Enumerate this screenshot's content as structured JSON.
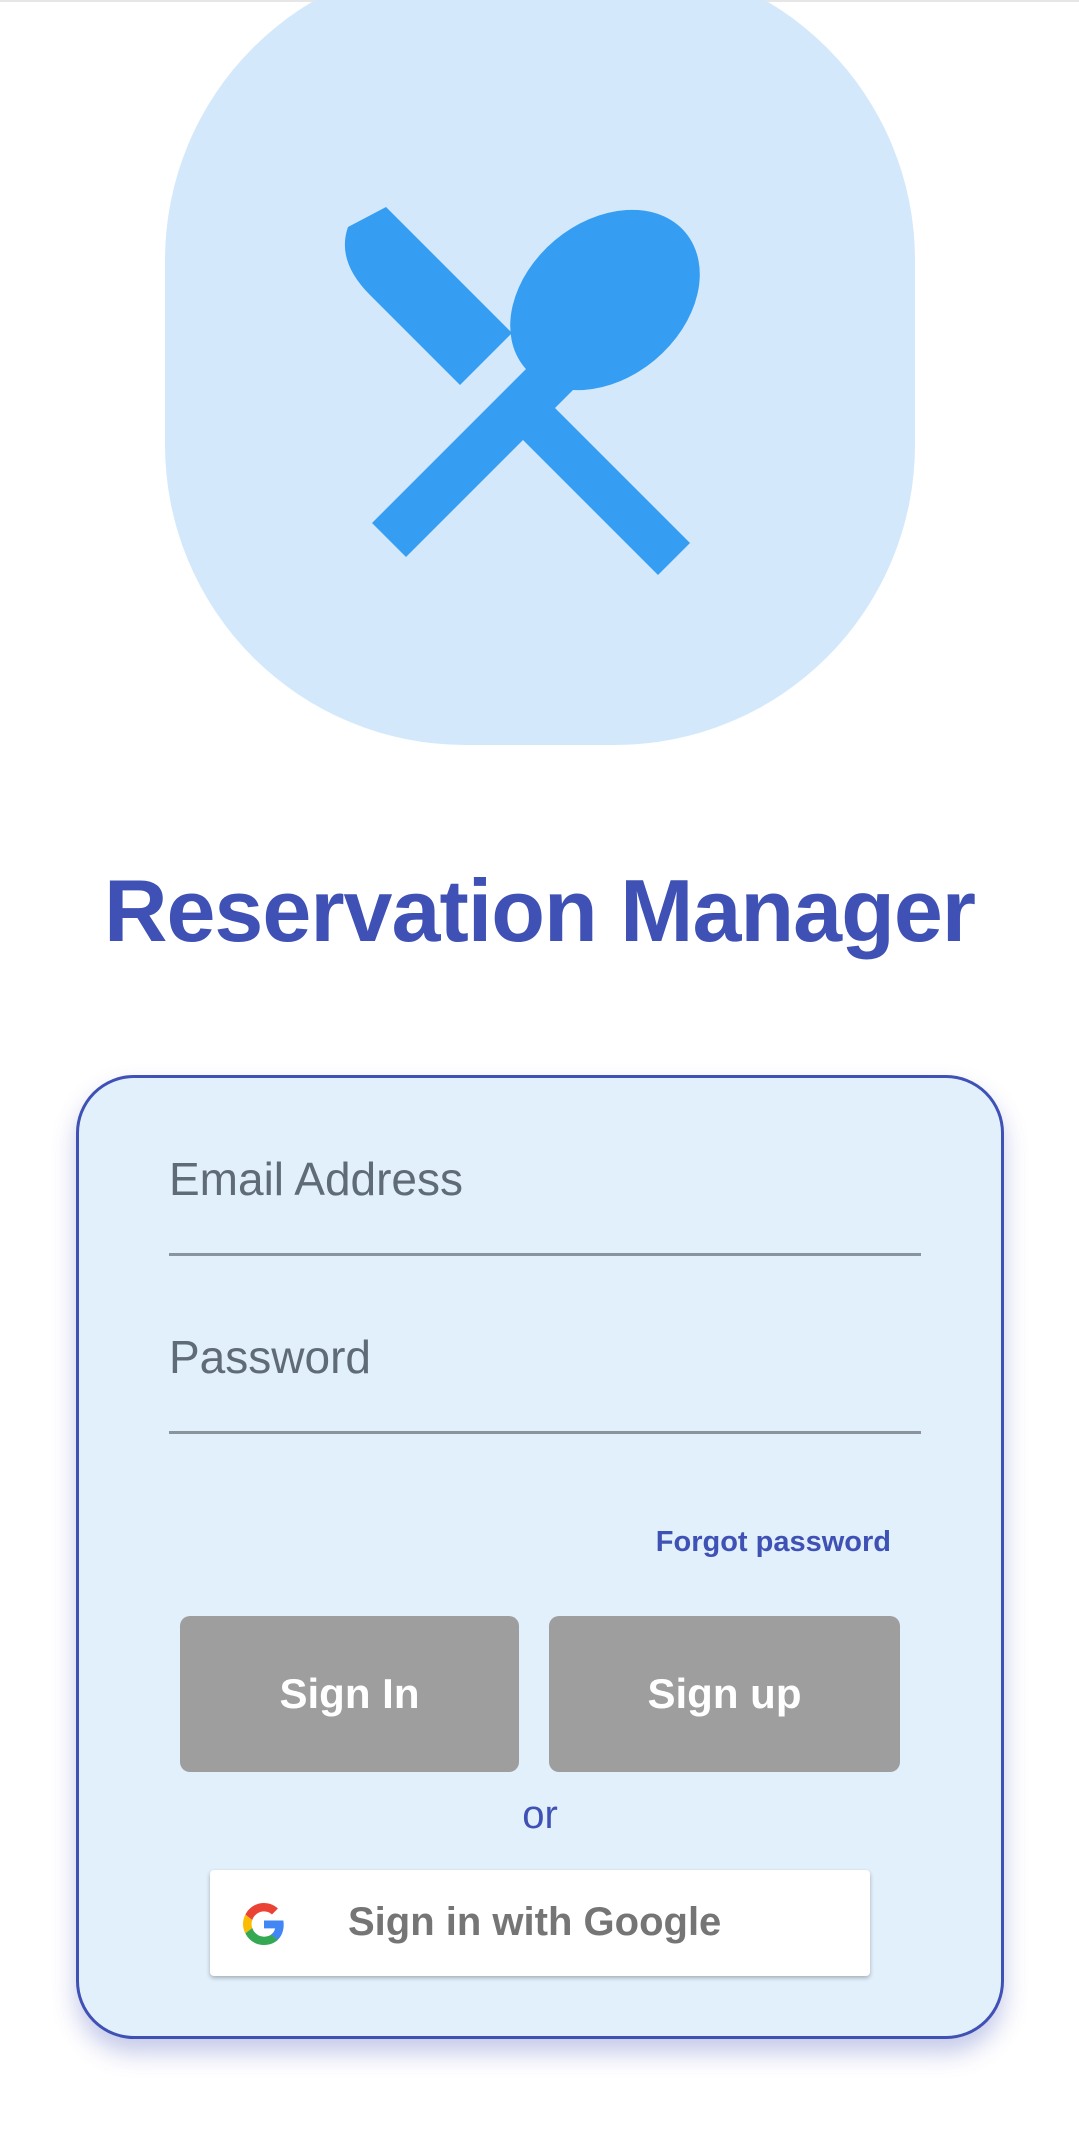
{
  "app": {
    "title": "Reservation Manager",
    "logo_icon": "restaurant-icon"
  },
  "login": {
    "email_label": "Email Address",
    "email_value": "",
    "password_label": "Password",
    "password_value": "",
    "forgot_password": "Forgot password",
    "sign_in": "Sign In",
    "sign_up": "Sign up",
    "or": "or",
    "google_sign_in": "Sign in with Google",
    "google_icon": "google-g-icon"
  },
  "colors": {
    "primary": "#3f51b5",
    "logo_background": "#d3e9fb",
    "logo_icon": "#359df2",
    "card_background": "#e2f0fc",
    "button_disabled": "#9e9e9e"
  }
}
